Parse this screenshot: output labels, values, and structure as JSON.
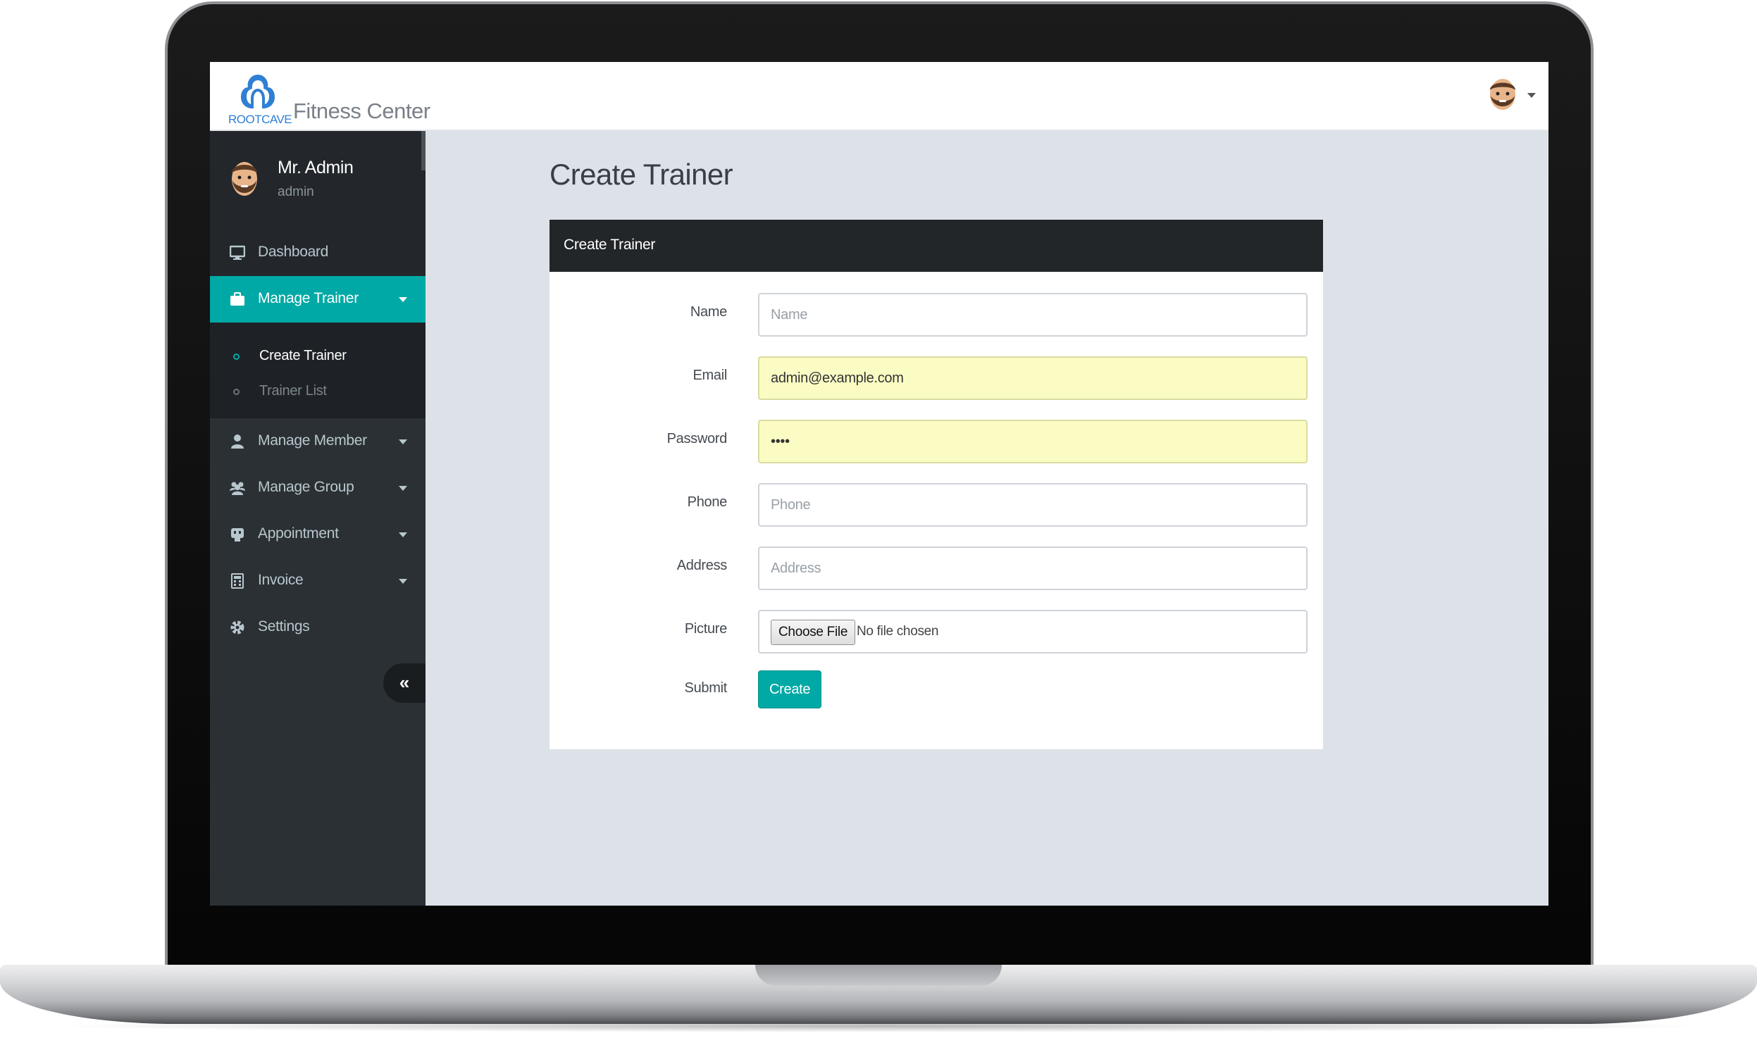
{
  "brand": {
    "small_text": "ROOTCAVE",
    "title": "Fitness Center",
    "accent_color": "#00a9a5",
    "logo_color": "#2f7fd4"
  },
  "header": {
    "avatar_icon": "bearded-man-avatar-icon",
    "dropdown_icon": "caret-down-icon"
  },
  "user": {
    "name": "Mr. Admin",
    "role": "admin"
  },
  "sidebar": {
    "items": [
      {
        "label": "Dashboard",
        "icon": "desktop-icon",
        "active": false
      },
      {
        "label": "Manage Trainer",
        "icon": "briefcase-icon",
        "active": true,
        "expanded": true,
        "children": [
          {
            "label": "Create Trainer",
            "active": true
          },
          {
            "label": "Trainer List",
            "active": false
          }
        ]
      },
      {
        "label": "Manage Member",
        "icon": "user-icon",
        "active": false
      },
      {
        "label": "Manage Group",
        "icon": "users-icon",
        "active": false
      },
      {
        "label": "Appointment",
        "icon": "appointment-icon",
        "active": false
      },
      {
        "label": "Invoice",
        "icon": "calculator-icon",
        "active": false
      },
      {
        "label": "Settings",
        "icon": "gear-icon",
        "active": false
      }
    ],
    "collapse_glyph": "«"
  },
  "main": {
    "page_title": "Create Trainer",
    "card_title": "Create Trainer",
    "form": {
      "name": {
        "label": "Name",
        "value": "",
        "placeholder": "Name"
      },
      "email": {
        "label": "Email",
        "value": "admin@example.com",
        "placeholder": ""
      },
      "password": {
        "label": "Password",
        "value": "••••",
        "placeholder": ""
      },
      "phone": {
        "label": "Phone",
        "value": "",
        "placeholder": "Phone"
      },
      "address": {
        "label": "Address",
        "value": "",
        "placeholder": "Address"
      },
      "picture": {
        "label": "Picture",
        "button": "Choose File",
        "status": "No file chosen"
      },
      "submit": {
        "label": "Submit",
        "button": "Create"
      }
    }
  }
}
